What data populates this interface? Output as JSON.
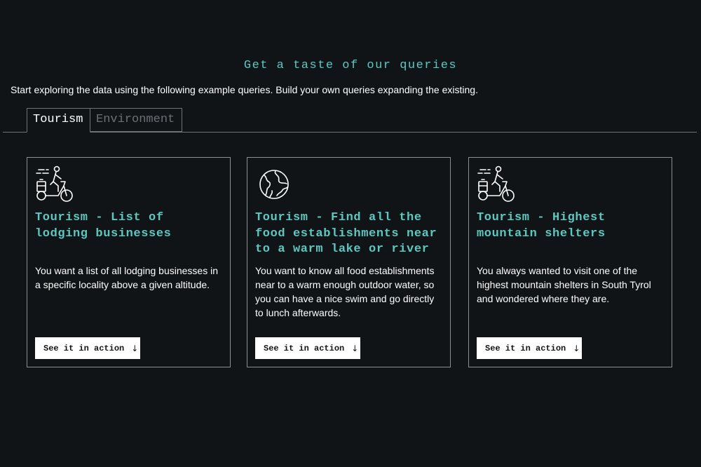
{
  "header": {
    "title": "Get a taste of our queries",
    "intro": "Start exploring the data using the following example queries. Build your own queries expanding the existing."
  },
  "tabs": [
    {
      "label": "Tourism",
      "active": true
    },
    {
      "label": "Environment",
      "active": false
    }
  ],
  "cards": [
    {
      "icon": "cyclist-luggage-icon",
      "title": "Tourism - List of lodging businesses",
      "description": "You want a list of all lodging businesses in a specific locality above a given altitude.",
      "button_label": "See it in action",
      "button_arrow": "↓"
    },
    {
      "icon": "globe-icon",
      "title": "Tourism - Find all the food establishments near to a warm lake or river",
      "description": "You want to know all food establishments near to a warm enough outdoor water, so you can have a nice swim and go directly to lunch afterwards.",
      "button_label": "See it in action",
      "button_arrow": "↓"
    },
    {
      "icon": "cyclist-luggage-icon",
      "title": "Tourism - Highest mountain shelters",
      "description": "You always wanted to visit one of the highest mountain shelters in South Tyrol and wondered where they are.",
      "button_label": "See it in action",
      "button_arrow": "↓"
    }
  ],
  "colors": {
    "background": "#111417",
    "accent": "#5cc8c0",
    "border": "#8a8f94",
    "inactive_tab_text": "#6c7074"
  }
}
